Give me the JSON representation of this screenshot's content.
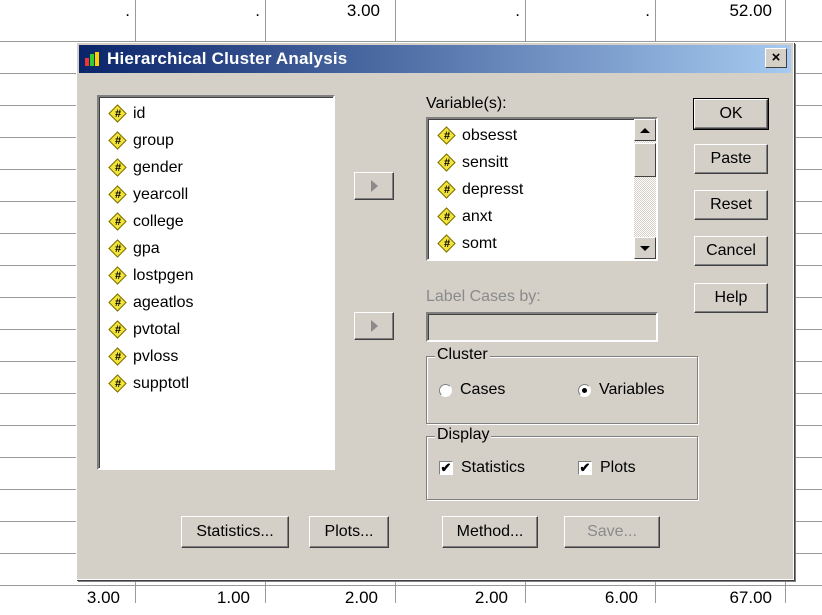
{
  "spreadsheet": {
    "top_row": [
      "",
      ".",
      ".",
      "3.00",
      ".",
      ".",
      "52.00"
    ],
    "bottom_row": [
      "",
      "3.00",
      "1.00",
      "2.00",
      "2.00",
      "6.00",
      "67.00"
    ]
  },
  "dialog": {
    "title": "Hierarchical Cluster Analysis",
    "close_label": "×",
    "source_variables": [
      "id",
      "group",
      "gender",
      "yearcoll",
      "college",
      "gpa",
      "lostpgen",
      "ageatlos",
      "pvtotal",
      "pvloss",
      "supptotl"
    ],
    "variables_label": "Variable(s):",
    "selected_variables": [
      "obsesst",
      "sensitt",
      "depresst",
      "anxt",
      "somt"
    ],
    "label_cases_label": "Label Cases by:",
    "label_cases_value": "",
    "cluster": {
      "title": "Cluster",
      "options": [
        "Cases",
        "Variables"
      ],
      "selected": "Variables"
    },
    "display": {
      "title": "Display",
      "statistics_label": "Statistics",
      "statistics_checked": true,
      "plots_label": "Plots",
      "plots_checked": true
    },
    "right_buttons": {
      "ok": "OK",
      "paste": "Paste",
      "reset": "Reset",
      "cancel": "Cancel",
      "help": "Help"
    },
    "bottom_buttons": {
      "statistics": "Statistics...",
      "plots": "Plots...",
      "method": "Method...",
      "save": "Save..."
    },
    "icon_glyph": "#",
    "check_glyph": "✔"
  }
}
